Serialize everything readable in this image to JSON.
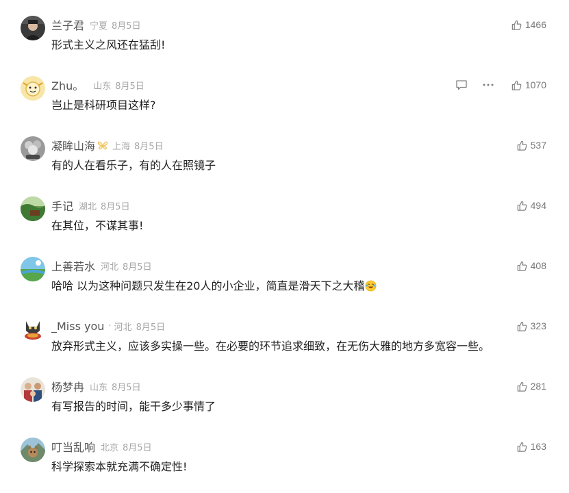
{
  "comments": [
    {
      "name": "兰子君",
      "location": "宁夏",
      "date": "8月5日",
      "text": "形式主义之风还在猛刮!",
      "likes": "1466"
    },
    {
      "name": "Zhu。",
      "location": "山东",
      "date": "8月5日",
      "text": "岂止是科研项目这样?",
      "likes": "1070"
    },
    {
      "name": "凝眸山海",
      "location": "上海",
      "date": "8月5日",
      "text": "有的人在看乐子，有的人在照镜子",
      "likes": "537",
      "badge_icon": "butterfly-badge-icon"
    },
    {
      "name": "手记",
      "location": "湖北",
      "date": "8月5日",
      "text": "在其位，不谋其事!",
      "likes": "494"
    },
    {
      "name": "上善若水",
      "location": "河北",
      "date": "8月5日",
      "text": "哈哈 以为这种问题只发生在20人的小企业，简直是滑天下之大稽",
      "likes": "408",
      "emoji_icon": "laughing-emoji-icon"
    },
    {
      "name": "_Miss you",
      "name_suffix": "·",
      "location": "河北",
      "date": "8月5日",
      "text": "放弃形式主义，应该多实操一些。在必要的环节追求细致，在无伤大雅的地方多宽容一些。",
      "likes": "323"
    },
    {
      "name": "杨梦冉",
      "location": "山东",
      "date": "8月5日",
      "text": "有写报告的时间，能干多少事情了",
      "likes": "281"
    },
    {
      "name": "叮当乱响",
      "location": "北京",
      "date": "8月5日",
      "text": "科学探索本就充满不确定性!",
      "likes": "163"
    }
  ],
  "hover_actions": {
    "comment_index": 1,
    "icons": [
      "reply-icon",
      "more-icon"
    ]
  },
  "colors": {
    "nickname": "#555555",
    "meta": "#a6a6a6",
    "text": "#222222",
    "like": "#777777"
  }
}
